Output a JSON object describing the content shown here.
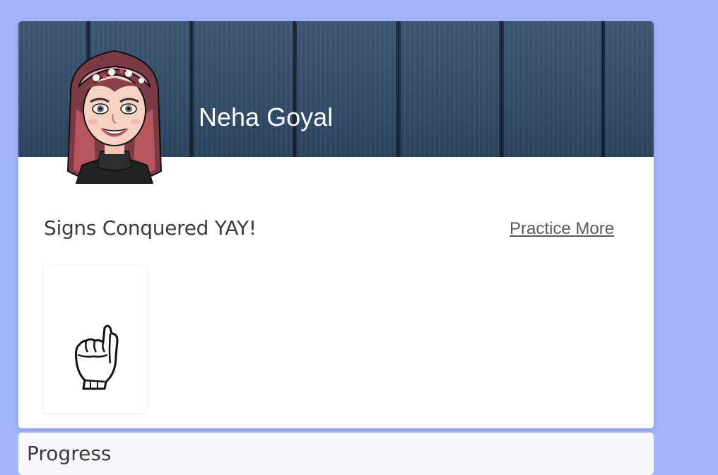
{
  "profile": {
    "name": "Neha Goyal",
    "avatar_icon": "bitmoji-avatar-icon"
  },
  "conquered": {
    "title": "Signs Conquered YAY!",
    "practice_link": "Practice More",
    "signs": [
      {
        "icon": "asl-hand-sign-icon"
      }
    ]
  },
  "progress": {
    "title": "Progress"
  },
  "colors": {
    "page_background": "#a3b5fb",
    "banner": "#354e6b",
    "card": "#ffffff"
  }
}
